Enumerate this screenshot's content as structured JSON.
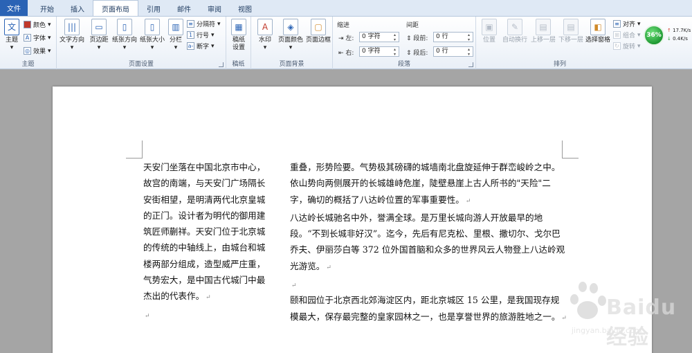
{
  "tabs": [
    "文件",
    "开始",
    "插入",
    "页面布局",
    "引用",
    "邮件",
    "审阅",
    "视图"
  ],
  "ribbon": {
    "theme": {
      "label": "主题",
      "theme_btn": "主题",
      "colors": "颜色",
      "fonts": "字体",
      "effects": "效果"
    },
    "page_setup": {
      "label": "页面设置",
      "text_direction": "文字方向",
      "margins": "页边距",
      "orientation": "纸张方向",
      "size": "纸张大小",
      "columns": "分栏",
      "breaks": "分隔符",
      "line_numbers": "行号",
      "hyphenation": "断字"
    },
    "manuscript": {
      "label": "稿纸",
      "manuscript_setup": "稿纸设置"
    },
    "page_background": {
      "label": "页面背景",
      "watermark": "水印",
      "page_color": "页面颜色",
      "page_borders": "页面边框"
    },
    "paragraph": {
      "label": "段落",
      "indent": "缩进",
      "spacing": "间距",
      "left": "左:",
      "left_value": "0 字符",
      "right": "右:",
      "right_value": "0 字符",
      "before": "段前:",
      "before_value": "0 行",
      "after": "段后:",
      "after_value": "0 行"
    },
    "arrange": {
      "label": "排列",
      "position": "位置",
      "wrap_text": "自动换行",
      "bring_forward": "上移一层",
      "send_backward": "下移一层",
      "selection_pane": "选择窗格",
      "align": "对齐",
      "group": "组合",
      "rotate": "旋转"
    }
  },
  "widget": {
    "percent": "36%",
    "up_speed": "17.7K/s",
    "down_speed": "0.4K/s"
  },
  "document": {
    "col1": [
      "天安门坐落在中国北京市中心，故宫的南端，与天安门广场隔长安街相望，是明清两代北京皇城的正门。设计者为明代的御用建筑匠师蒯祥。天安门位于北京城的传统的中轴线上，由城台和城楼两部分组成，造型威严庄重，气势宏大，是中国古代城门中最杰出的代表作。"
    ],
    "col2_p1": "重叠，形势险要。气势极其磅礴的城墙南北盘旋延伸于群峦峻岭之中。依山势向两侧展开的长城雄峙危崖，陡壁悬崖上古人所书的\"天险\"二字，确切的概括了八达岭位置的军事重要性。",
    "col2_p2": "八达岭长城驰名中外，誉满全球。是万里长城向游人开放最早的地段。“不到长城非好汉”。迄今，先后有尼克松、里根、撒切尔、戈尔巴乔夫、伊丽莎白等 372 位外国首脑和众多的世界风云人物登上八达岭观光游览。",
    "col2_p3": "颐和园位于北京西北郊海淀区内，距北京城区 15 公里，是我国现存规模最大，保存最完整的皇家园林之一，也是享誉世界的旅游胜地之一。",
    "para_mark": "↵"
  },
  "watermark": {
    "brand": "Baidu经验",
    "url": "jingyan.baidu.com"
  }
}
